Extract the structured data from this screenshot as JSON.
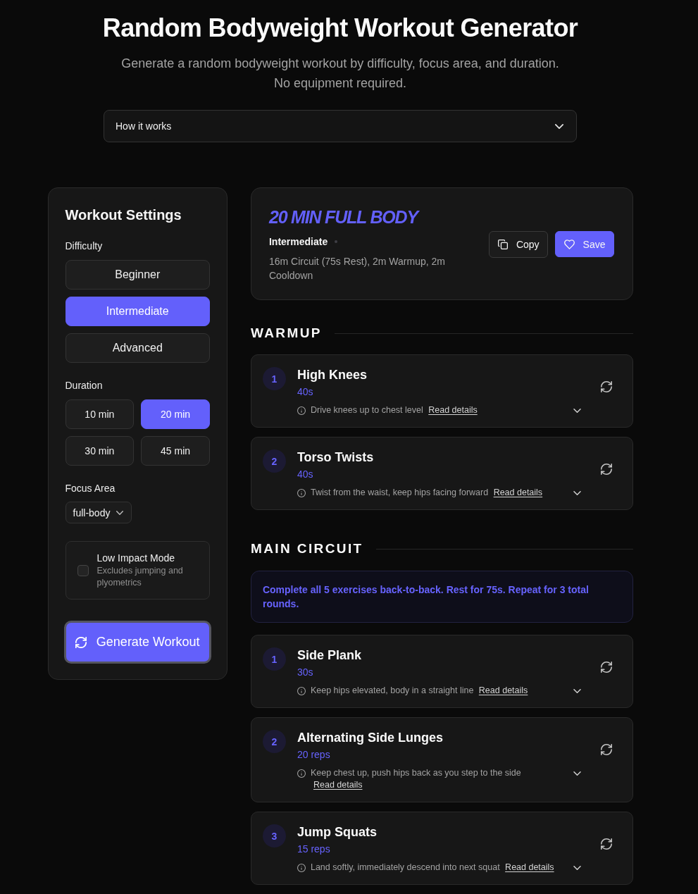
{
  "header": {
    "title": "Random Bodyweight Workout Generator",
    "subtitle": "Generate a random bodyweight workout by difficulty, focus area, and duration. No equipment required."
  },
  "how_it_works": {
    "label": "How it works",
    "expanded": false
  },
  "settings": {
    "title": "Workout Settings",
    "difficulty": {
      "label": "Difficulty",
      "options": [
        {
          "label": "Beginner",
          "selected": false
        },
        {
          "label": "Intermediate",
          "selected": true
        },
        {
          "label": "Advanced",
          "selected": false
        }
      ]
    },
    "duration": {
      "label": "Duration",
      "options": [
        {
          "label": "10 min",
          "selected": false
        },
        {
          "label": "20 min",
          "selected": true
        },
        {
          "label": "30 min",
          "selected": false
        },
        {
          "label": "45 min",
          "selected": false
        }
      ]
    },
    "focus_area": {
      "label": "Focus Area",
      "value": "full-body"
    },
    "low_impact": {
      "label": "Low Impact Mode",
      "description": "Excludes jumping and plyometrics",
      "checked": false
    },
    "generate_button": "Generate Workout"
  },
  "summary": {
    "title": "20 MIN FULL BODY",
    "difficulty": "Intermediate",
    "description": "16m Circuit (75s Rest), 2m Warmup, 2m Cooldown",
    "buttons": [
      {
        "label": "Copy",
        "kind": "copy"
      },
      {
        "label": "Save",
        "kind": "save"
      }
    ]
  },
  "sections": [
    {
      "title": "WARMUP",
      "exercises": [
        {
          "number": "1",
          "name": "High Knees",
          "amount": "40s",
          "tip": "Drive knees up to chest level",
          "link": "Read details",
          "expanded": false
        },
        {
          "number": "2",
          "name": "Torso Twists",
          "amount": "40s",
          "tip": "Twist from the waist, keep hips facing forward",
          "link": "Read details",
          "expanded": false
        }
      ]
    },
    {
      "title": "MAIN CIRCUIT",
      "note": "Complete all 5 exercises back-to-back. Rest for 75s. Repeat for 3 total rounds.",
      "exercises": [
        {
          "number": "1",
          "name": "Side Plank",
          "amount": "30s",
          "tip": "Keep hips elevated, body in a straight line",
          "link": "Read details",
          "expanded": false
        },
        {
          "number": "2",
          "name": "Alternating Side Lunges",
          "amount": "20 reps",
          "tip": "Keep chest up, push hips back as you step to the side",
          "link": "Read details",
          "expanded": false
        },
        {
          "number": "3",
          "name": "Jump Squats",
          "amount": "15 reps",
          "tip": "Land softly, immediately descend into next squat",
          "link": "Read details",
          "expanded": false
        }
      ]
    }
  ]
}
